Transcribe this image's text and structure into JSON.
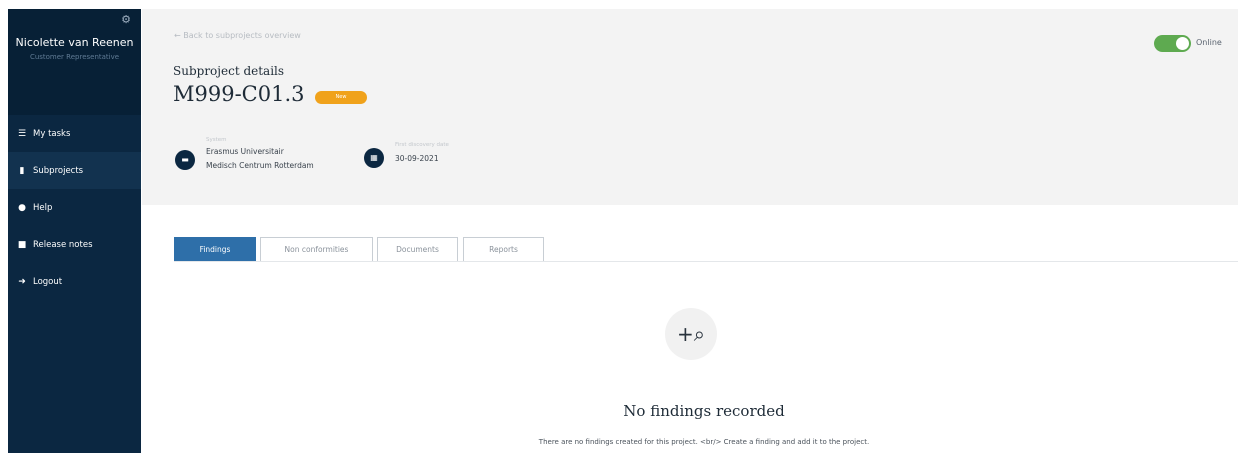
{
  "sidebar": {
    "user_name": "Nicolette van Reenen",
    "user_role": "Customer Representative",
    "items": [
      {
        "label": "My tasks",
        "icon": "list-icon"
      },
      {
        "label": "Subprojects",
        "icon": "file-icon"
      },
      {
        "label": "Help",
        "icon": "question-icon"
      },
      {
        "label": "Release notes",
        "icon": "note-icon"
      },
      {
        "label": "Logout",
        "icon": "logout-icon"
      }
    ]
  },
  "header": {
    "back_link": "← Back to subprojects overview",
    "subtitle": "Subproject details",
    "code": "M999-C01.3",
    "status_badge": "New",
    "online_label": "Online",
    "meta": {
      "system_label": "System",
      "system_value_line1": "Erasmus Universitair",
      "system_value_line2": "Medisch Centrum Rotterdam",
      "date_label": "First discovery date",
      "date_value": "30-09-2021"
    }
  },
  "tabs": [
    {
      "label": "Findings",
      "active": true
    },
    {
      "label": "Non conformities",
      "active": false
    },
    {
      "label": "Documents",
      "active": false
    },
    {
      "label": "Reports",
      "active": false
    }
  ],
  "empty_state": {
    "title": "No findings recorded",
    "description": "There are no findings created for this project. <br/> Create a finding and add it to the project."
  },
  "colors": {
    "sidebar_bg": "#0b2741",
    "accent_blue": "#2e6fa9",
    "badge_orange": "#f0a21b",
    "toggle_green": "#5eaa50"
  }
}
